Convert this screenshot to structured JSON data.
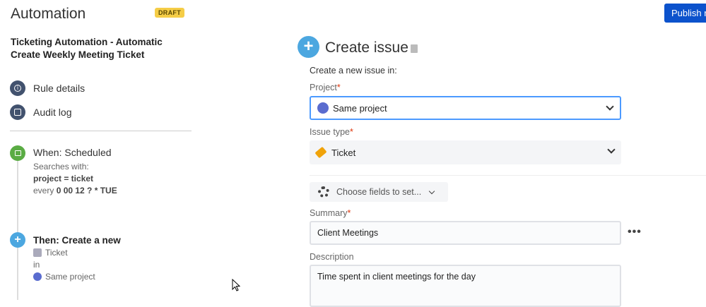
{
  "header": {
    "title": "Automation",
    "status_badge": "DRAFT",
    "publish_label": "Publish rule"
  },
  "sidebar": {
    "rule_name": "Ticketing Automation - Automatic Create Weekly Meeting Ticket",
    "nav": [
      {
        "label": "Rule details",
        "icon": "info-icon"
      },
      {
        "label": "Audit log",
        "icon": "list-icon"
      }
    ],
    "trigger": {
      "title": "When: Scheduled",
      "line1": "Searches with:",
      "jql": "project = ticket",
      "every_prefix": "every",
      "cron": "0 00 12 ? * TUE"
    },
    "action": {
      "title": "Then: Create a new",
      "issue_type": "Ticket",
      "in": "in",
      "project": "Same project"
    }
  },
  "panel": {
    "title": "Create issue",
    "intro": "Create a new issue in:",
    "project_label": "Project",
    "project_value": "Same project",
    "issue_type_label": "Issue type",
    "issue_type_value": "Ticket",
    "choose_fields": "Choose fields to set...",
    "summary_label": "Summary",
    "summary_value": "Client Meetings",
    "description_label": "Description",
    "description_value": "Time spent in client meetings for the day",
    "required_mark": "*"
  },
  "colors": {
    "accent": "#0c52cc",
    "draft": "#f5cd47",
    "trigger": "#5aac44",
    "action": "#4ca7e0"
  }
}
